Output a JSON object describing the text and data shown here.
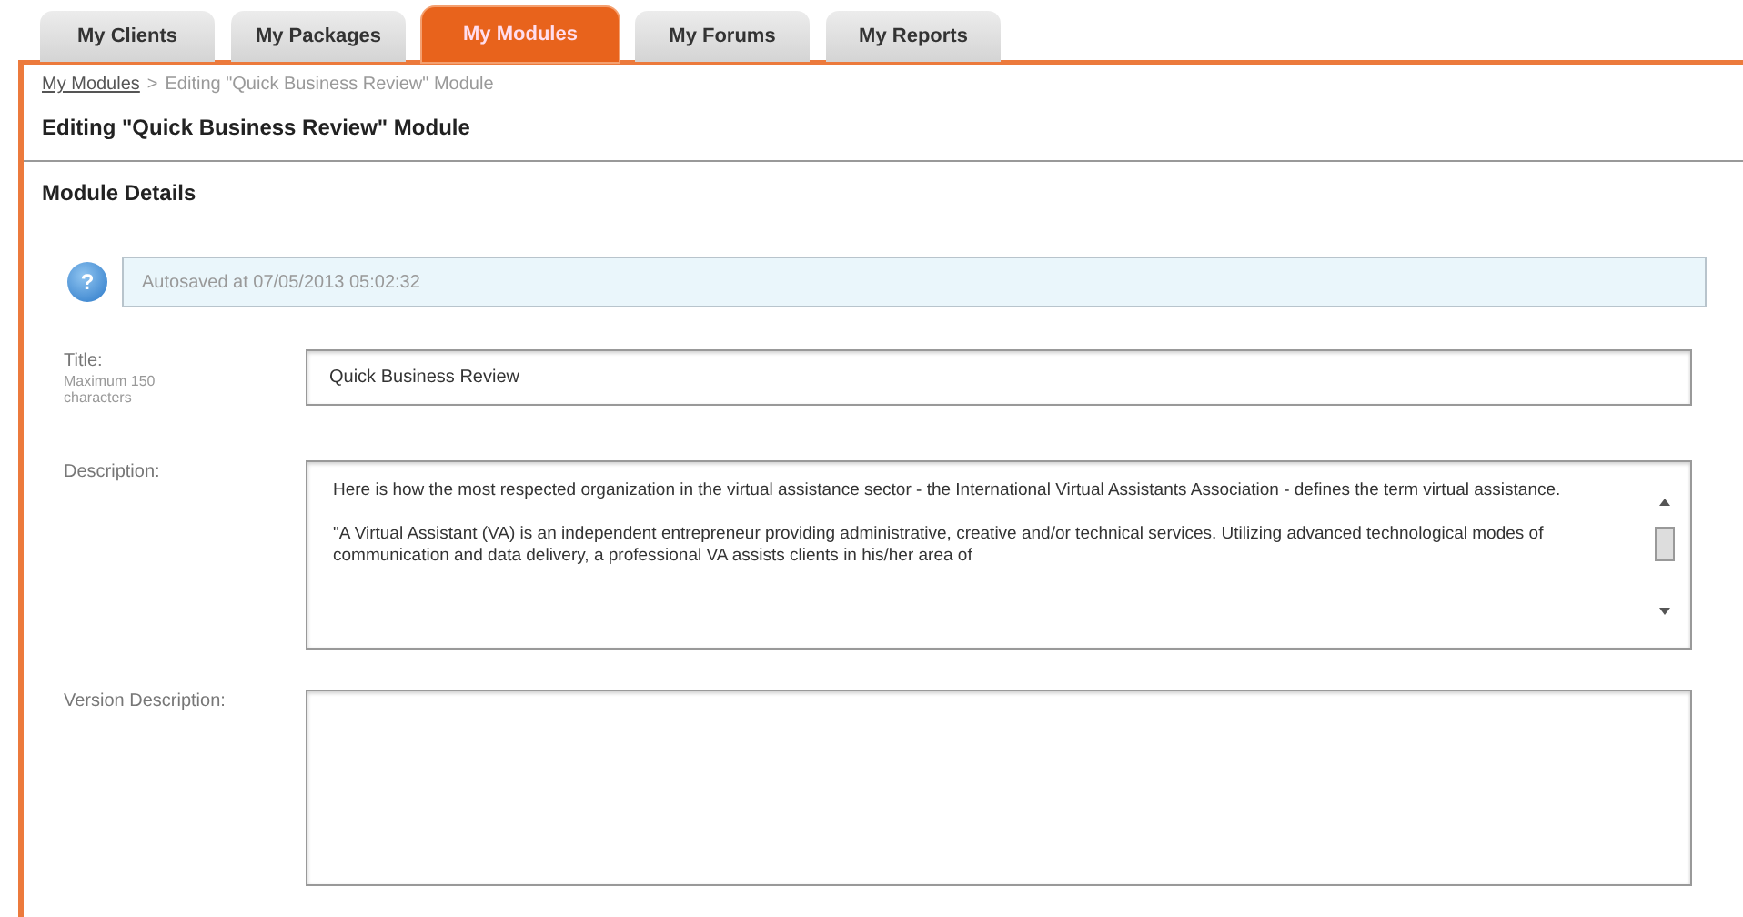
{
  "tabs": [
    {
      "label": "My Clients",
      "selected": false
    },
    {
      "label": "My Packages",
      "selected": false
    },
    {
      "label": "My Modules",
      "selected": true
    },
    {
      "label": "My Forums",
      "selected": false
    },
    {
      "label": "My Reports",
      "selected": false
    }
  ],
  "breadcrumb": {
    "link": "My Modules",
    "separator": ">",
    "current": "Editing \"Quick Business Review\" Module"
  },
  "page_title": "Editing \"Quick Business Review\" Module",
  "section_title": "Module Details",
  "notice": {
    "icon": "?",
    "text": "Autosaved at 07/05/2013 05:02:32"
  },
  "fields": [
    {
      "label": "Title:",
      "hint": "Maximum 150 characters",
      "kind": "input",
      "value": "Quick Business Review"
    },
    {
      "label": "Description:",
      "kind": "textarea",
      "paragraphs": [
        "Here is how the most respected organization in the virtual assistance sector - the International Virtual Assistants Association - defines the term virtual assistance.",
        "\"A Virtual Assistant (VA) is an independent entrepreneur providing administrative, creative and/or technical services. Utilizing advanced technological modes of communication and data delivery, a professional VA assists clients in his/her area of"
      ]
    },
    {
      "label": "Version Description:",
      "kind": "empty-textarea"
    }
  ]
}
